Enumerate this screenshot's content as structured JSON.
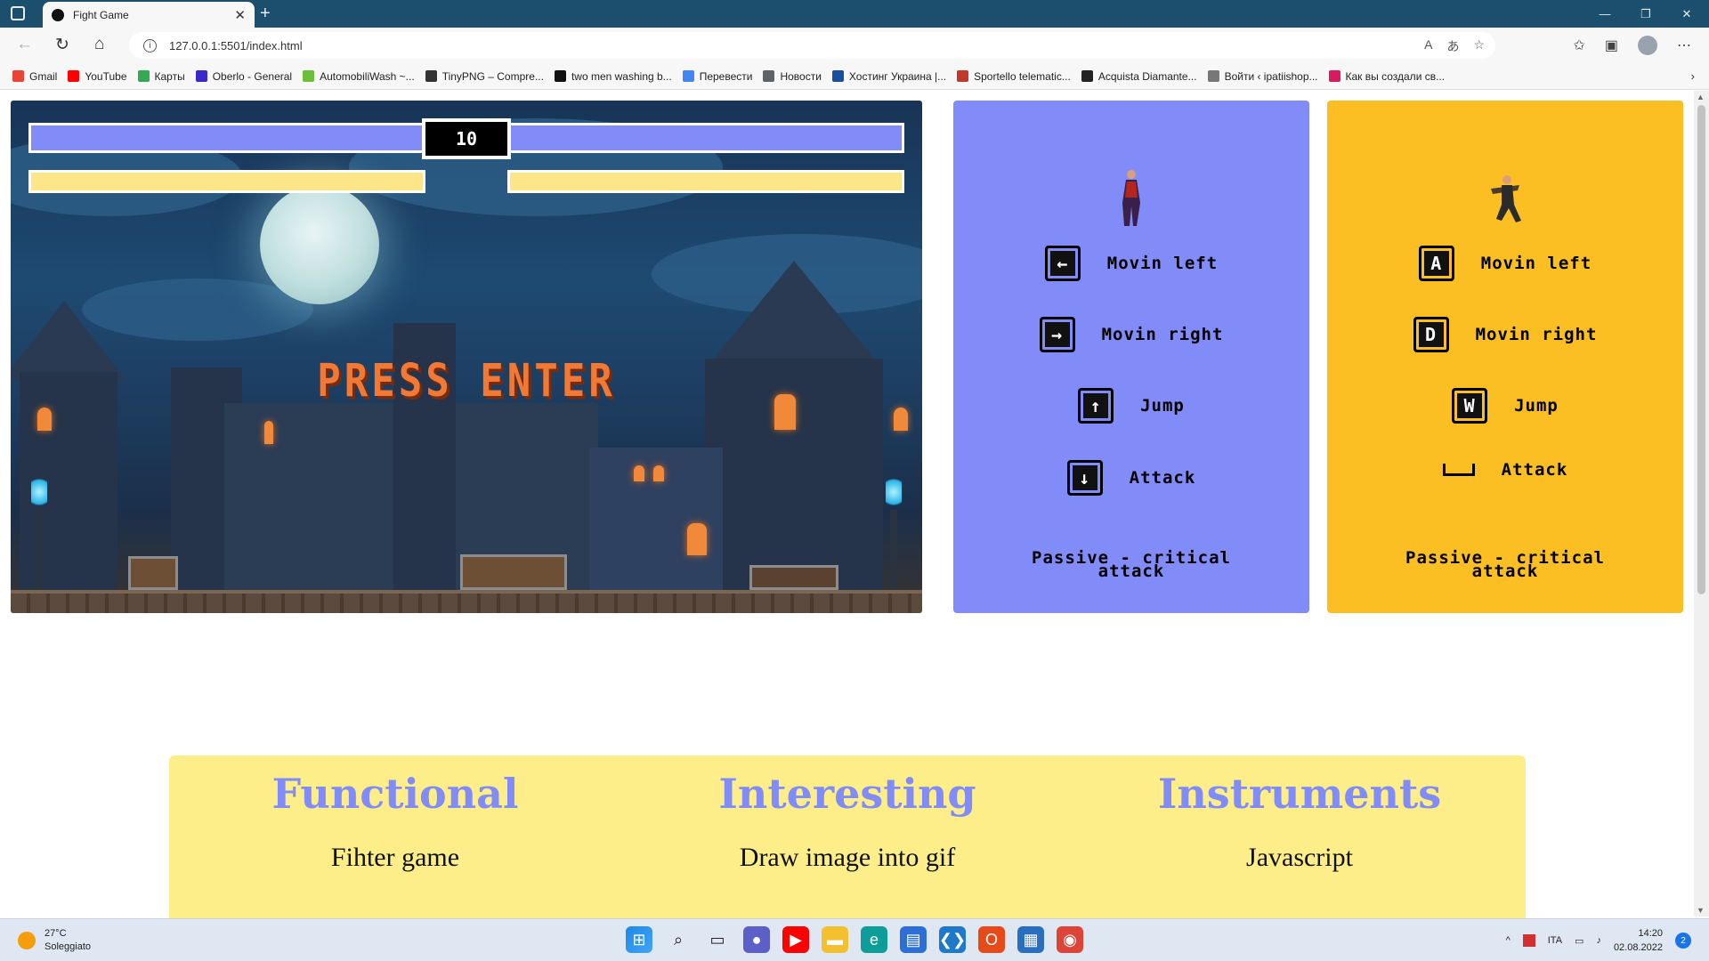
{
  "browser": {
    "tab_title": "Fight Game",
    "url": "127.0.0.1:5501/index.html",
    "bookmarks": [
      {
        "label": "Gmail",
        "color": "#ea4335"
      },
      {
        "label": "YouTube",
        "color": "#ff0000"
      },
      {
        "label": "Карты",
        "color": "#34a853"
      },
      {
        "label": "Oberlo - General",
        "color": "#3b28cc"
      },
      {
        "label": "AutomobiliWash ~...",
        "color": "#6bbf3a"
      },
      {
        "label": "TinyPNG – Compre...",
        "color": "#333333"
      },
      {
        "label": "two men washing b...",
        "color": "#111111"
      },
      {
        "label": "Перевести",
        "color": "#4285f4"
      },
      {
        "label": "Новости",
        "color": "#5f6368"
      },
      {
        "label": "Хостинг Украина |...",
        "color": "#1a4fa0"
      },
      {
        "label": "Sportello telematic...",
        "color": "#c0392b"
      },
      {
        "label": "Acquista Diamante...",
        "color": "#222222"
      },
      {
        "label": "Войти ‹ ipatiishop...",
        "color": "#777777"
      },
      {
        "label": "Как вы создали св...",
        "color": "#d81b60"
      }
    ]
  },
  "game": {
    "timer": "10",
    "overlay_text": "PRESS ENTER"
  },
  "player1": {
    "color": "#818cf8",
    "controls": [
      {
        "key": "←",
        "label": "Movin left"
      },
      {
        "key": "→",
        "label": "Movin right"
      },
      {
        "key": "↑",
        "label": "Jump"
      },
      {
        "key": "↓",
        "label": "Attack"
      }
    ],
    "passive": "Passive - critical attack"
  },
  "player2": {
    "color": "#fbbf24",
    "controls": [
      {
        "key": "A",
        "label": "Movin left"
      },
      {
        "key": "D",
        "label": "Movin right"
      },
      {
        "key": "W",
        "label": "Jump"
      },
      {
        "key": "␣",
        "label": "Attack"
      }
    ],
    "passive": "Passive - critical attack"
  },
  "info": [
    {
      "heading": "Functional",
      "text": "Fihter game"
    },
    {
      "heading": "Interesting",
      "text": "Draw image into gif"
    },
    {
      "heading": "Instruments",
      "text": "Javascript"
    }
  ],
  "taskbar": {
    "temperature": "27°C",
    "weather": "Soleggiato",
    "language": "ITA",
    "time": "14:20",
    "date": "02.08.2022",
    "notifications": "2"
  }
}
